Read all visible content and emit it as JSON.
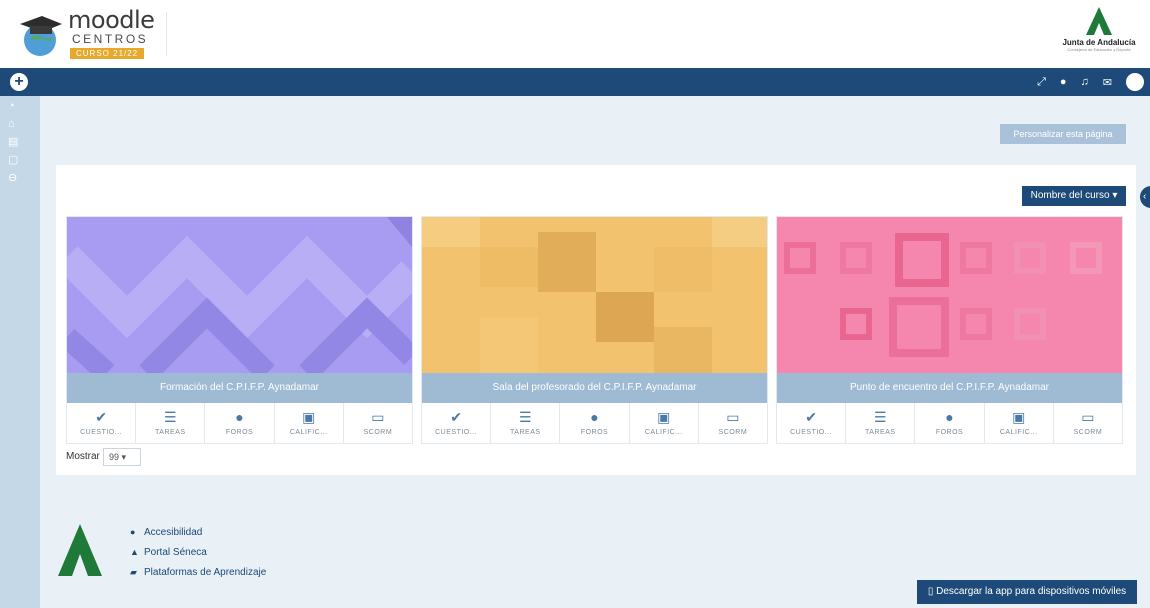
{
  "header": {
    "logo_word": "moodle",
    "logo_sub": "CENTROS",
    "logo_badge": "CURSO 21/22",
    "junta_title": "Junta de Andalucía",
    "junta_sub": "Consejería de Educación y Deporte"
  },
  "navbar": {
    "add_icon": "plus-icon",
    "icons": [
      "expand-icon",
      "help-icon",
      "bell-icon",
      "envelope-icon",
      "avatar"
    ]
  },
  "sidebar": {
    "items": [
      "dashboard-icon",
      "home-icon",
      "calendar-icon",
      "files-icon",
      "courses-icon"
    ]
  },
  "main": {
    "customize_label": "Personalizar esta página",
    "sort_label": "Nombre del curso ▾",
    "edge_tab": "‹",
    "cards": [
      {
        "title": "Formación del C.P.I.F.P. Aynadamar",
        "mods": [
          "CUESTIO...",
          "TAREAS",
          "FOROS",
          "CALIFIC...",
          "SCORM"
        ]
      },
      {
        "title": "Sala del profesorado del C.P.I.F.P. Aynadamar",
        "mods": [
          "CUESTIO...",
          "TAREAS",
          "FOROS",
          "CALIFIC...",
          "SCORM"
        ]
      },
      {
        "title": "Punto de encuentro del C.P.I.F.P. Aynadamar",
        "mods": [
          "CUESTIO...",
          "TAREAS",
          "FOROS",
          "CALIFIC...",
          "SCORM"
        ]
      }
    ],
    "show_label": "Mostrar",
    "show_value": "99 ▾"
  },
  "footer": {
    "links": [
      "Accesibilidad",
      "Portal Séneca",
      "Plataformas de Aprendizaje"
    ],
    "app_button": "Descargar la app para dispositivos móviles"
  },
  "colors": {
    "navy": "#1d4a78",
    "card1": "#a89cf2",
    "card2": "#f2c26e",
    "card3": "#f586ad",
    "junta_green": "#1f7a3a"
  }
}
